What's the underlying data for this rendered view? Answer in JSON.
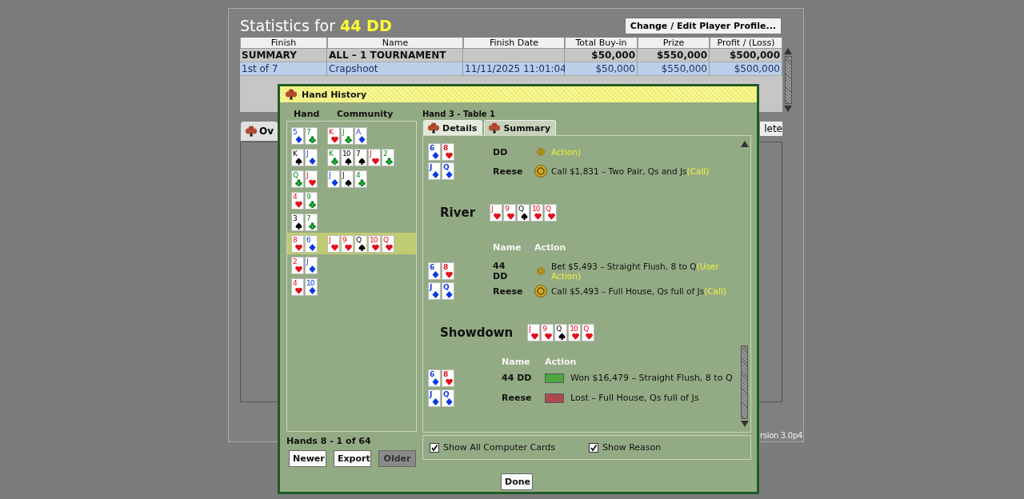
{
  "title": {
    "prefix": "Statistics for",
    "player": "44 DD"
  },
  "profile_button": "Change / Edit Player Profile...",
  "table": {
    "columns": [
      "Finish",
      "Name",
      "Finish Date",
      "Total Buy-in",
      "Prize",
      "Profit / (Loss)"
    ],
    "rows": [
      {
        "kind": "summary",
        "selected": false,
        "cells": [
          "SUMMARY",
          "ALL – 1 TOURNAMENT",
          "",
          "$50,000",
          "$550,000",
          "$500,000"
        ]
      },
      {
        "kind": "tournament",
        "selected": true,
        "cells": [
          "1st of 7",
          "Crapshoot",
          "11/11/2025 11:01:04",
          "$50,000",
          "$550,000",
          "$500,000"
        ]
      }
    ]
  },
  "background_tab": "Ov",
  "background_button": "lete",
  "version_text": "rsion 3.0p4",
  "dialog": {
    "title": "Hand History",
    "hand_list": {
      "columns": [
        "Hand",
        "Community"
      ],
      "rows": [
        {
          "selected": false,
          "hand": [
            {
              "rank": "5",
              "kind": "diamond"
            },
            {
              "rank": "7",
              "kind": "club"
            }
          ],
          "community": [
            {
              "rank": "K",
              "kind": "heart"
            },
            {
              "rank": "J",
              "kind": "club"
            },
            {
              "rank": "A",
              "kind": "diamond"
            }
          ]
        },
        {
          "selected": false,
          "hand": [
            {
              "rank": "K",
              "kind": "spade"
            },
            {
              "rank": "J",
              "kind": "diamond"
            }
          ],
          "community": [
            {
              "rank": "K",
              "kind": "club"
            },
            {
              "rank": "10",
              "kind": "spade"
            },
            {
              "rank": "7",
              "kind": "spade"
            },
            {
              "rank": "J",
              "kind": "heart"
            },
            {
              "rank": "2",
              "kind": "club"
            }
          ]
        },
        {
          "selected": false,
          "hand": [
            {
              "rank": "Q",
              "kind": "club"
            },
            {
              "rank": "J",
              "kind": "heart"
            }
          ],
          "community": [
            {
              "rank": "J",
              "kind": "diamond"
            },
            {
              "rank": "J",
              "kind": "spade"
            },
            {
              "rank": "4",
              "kind": "club"
            }
          ]
        },
        {
          "selected": false,
          "hand": [
            {
              "rank": "4",
              "kind": "heart"
            },
            {
              "rank": "9",
              "kind": "club"
            }
          ],
          "community": []
        },
        {
          "selected": false,
          "hand": [
            {
              "rank": "3",
              "kind": "spade"
            },
            {
              "rank": "7",
              "kind": "club"
            }
          ],
          "community": []
        },
        {
          "selected": true,
          "hand": [
            {
              "rank": "8",
              "kind": "heart"
            },
            {
              "rank": "6",
              "kind": "diamond"
            }
          ],
          "community": [
            {
              "rank": "J",
              "kind": "heart"
            },
            {
              "rank": "9",
              "kind": "heart"
            },
            {
              "rank": "Q",
              "kind": "spade"
            },
            {
              "rank": "10",
              "kind": "heart"
            },
            {
              "rank": "Q",
              "kind": "heart"
            }
          ]
        },
        {
          "selected": false,
          "hand": [
            {
              "rank": "2",
              "kind": "heart"
            },
            {
              "rank": "J",
              "kind": "diamond"
            }
          ],
          "community": []
        },
        {
          "selected": false,
          "hand": [
            {
              "rank": "4",
              "kind": "heart"
            },
            {
              "rank": "10",
              "kind": "diamond"
            }
          ],
          "community": []
        }
      ]
    },
    "hands_status": "Hands 8 - 1 of 64",
    "nav_buttons": [
      {
        "label": "Newer",
        "disabled": false
      },
      {
        "label": "Export",
        "disabled": false
      },
      {
        "label": "Older",
        "disabled": true
      }
    ],
    "hand_title": "Hand 3 - Table 1",
    "tabs": [
      {
        "label": "Details",
        "selected": true
      },
      {
        "label": "Summary",
        "selected": false
      }
    ],
    "details": [
      {
        "kind": "actions",
        "players": [
          {
            "cards": [
              {
                "rank": "6",
                "kind": "diamond"
              },
              {
                "rank": "8",
                "kind": "heart"
              }
            ],
            "name": "DD",
            "action": {
              "kind": "bet",
              "reason": "Action)"
            }
          },
          {
            "cards": [
              {
                "rank": "J",
                "kind": "diamond"
              },
              {
                "rank": "Q",
                "kind": "diamond"
              }
            ],
            "name": "Reese",
            "action": {
              "kind": "call",
              "text": "Call $1,831 – Two Pair, Qs and Js",
              "reason": "(Call)"
            }
          }
        ]
      },
      {
        "kind": "street",
        "title": "River",
        "cards": [
          {
            "rank": "J",
            "kind": "heart"
          },
          {
            "rank": "9",
            "kind": "heart"
          },
          {
            "rank": "Q",
            "kind": "spade"
          },
          {
            "rank": "10",
            "kind": "heart"
          },
          {
            "rank": "Q",
            "kind": "heart"
          }
        ]
      },
      {
        "kind": "actions",
        "columns": [
          "Name",
          "Action"
        ],
        "players": [
          {
            "cards": [
              {
                "rank": "6",
                "kind": "diamond"
              },
              {
                "rank": "8",
                "kind": "heart"
              }
            ],
            "name": "44 DD",
            "action": {
              "kind": "bet",
              "text": "Bet $5,493 – Straight Flush, 8 to Q",
              "reason": "(User Action)"
            }
          },
          {
            "cards": [
              {
                "rank": "J",
                "kind": "diamond"
              },
              {
                "rank": "Q",
                "kind": "diamond"
              }
            ],
            "name": "Reese",
            "action": {
              "kind": "call",
              "text": "Call $5,493 – Full House, Qs full of Js",
              "reason": "(Call)"
            }
          }
        ]
      },
      {
        "kind": "street",
        "title": "Showdown",
        "cards": [
          {
            "rank": "J",
            "kind": "heart"
          },
          {
            "rank": "9",
            "kind": "heart"
          },
          {
            "rank": "Q",
            "kind": "spade"
          },
          {
            "rank": "10",
            "kind": "heart"
          },
          {
            "rank": "Q",
            "kind": "heart"
          }
        ]
      },
      {
        "kind": "results",
        "columns": [
          "Name",
          "Action"
        ],
        "players": [
          {
            "cards": [
              {
                "rank": "6",
                "kind": "diamond"
              },
              {
                "rank": "8",
                "kind": "heart"
              }
            ],
            "name": "44 DD",
            "kind": "won",
            "text": "Won $16,479 – Straight Flush, 8 to Q"
          },
          {
            "cards": [
              {
                "rank": "J",
                "kind": "diamond"
              },
              {
                "rank": "Q",
                "kind": "diamond"
              }
            ],
            "name": "Reese",
            "kind": "lost",
            "text": "Lost – Full House, Qs full of Js"
          }
        ]
      }
    ],
    "options": [
      {
        "label": "Show All Computer Cards",
        "checked": true
      },
      {
        "label": "Show Reason",
        "checked": true
      }
    ],
    "done_button": "Done"
  }
}
